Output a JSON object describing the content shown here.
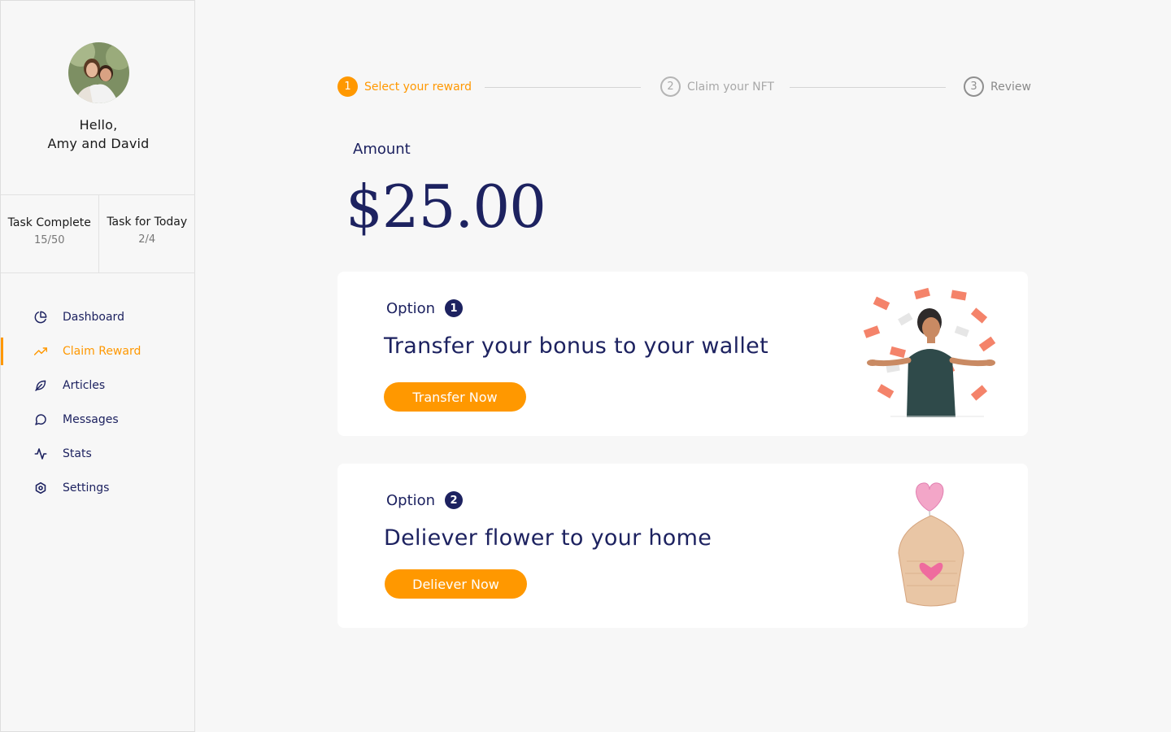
{
  "user": {
    "greeting": "Hello,",
    "name": "Amy and David"
  },
  "stats": [
    {
      "title": "Task Complete",
      "value": "15/50"
    },
    {
      "title": "Task for Today",
      "value": "2/4"
    }
  ],
  "nav": [
    {
      "label": "Dashboard",
      "icon": "pie-chart-icon",
      "active": false
    },
    {
      "label": "Claim Reward",
      "icon": "trending-up-icon",
      "active": true
    },
    {
      "label": "Articles",
      "icon": "leaf-icon",
      "active": false
    },
    {
      "label": "Messages",
      "icon": "message-circle-icon",
      "active": false
    },
    {
      "label": "Stats",
      "icon": "activity-icon",
      "active": false
    },
    {
      "label": "Settings",
      "icon": "settings-icon",
      "active": false
    }
  ],
  "stepper": [
    {
      "num": "1",
      "label": "Select your reward",
      "state": "active"
    },
    {
      "num": "2",
      "label": "Claim your NFT",
      "state": "pending"
    },
    {
      "num": "3",
      "label": "Review",
      "state": "pending"
    }
  ],
  "amount": {
    "label": "Amount",
    "value": "$25.00"
  },
  "options": [
    {
      "label": "Option",
      "num": "1",
      "title": "Transfer your bonus to your wallet",
      "button": "Transfer Now",
      "illustration": "person-with-money-illustration"
    },
    {
      "label": "Option",
      "num": "2",
      "title": "Deliever flower to your home",
      "button": "Deliever Now",
      "illustration": "flower-pot-illustration"
    }
  ],
  "colors": {
    "accent": "#ff9800",
    "navy": "#1d2260",
    "background": "#f7f7f7"
  }
}
